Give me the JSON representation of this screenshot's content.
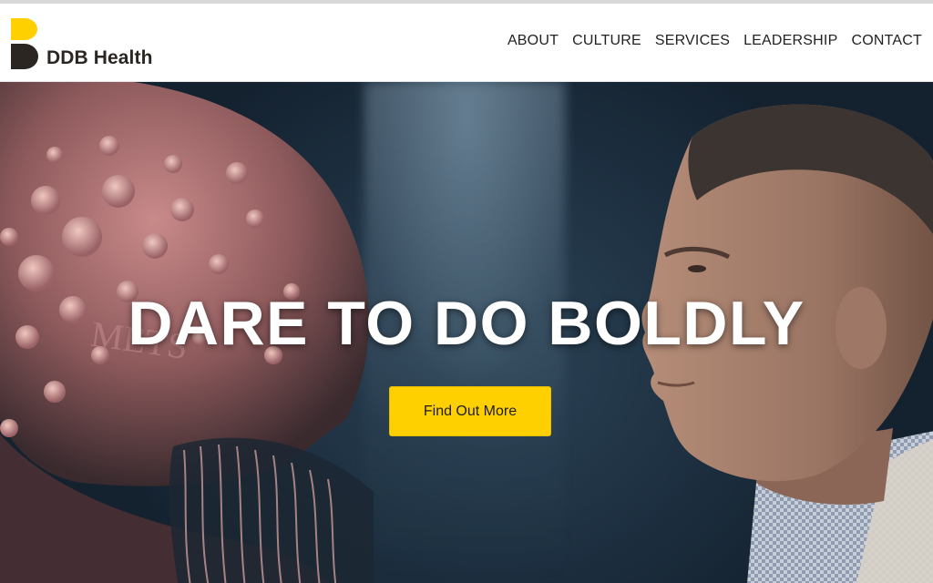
{
  "brand": {
    "name": "DDB Health",
    "logo_icon": "ddb-b-mark",
    "colors": {
      "yellow": "#ffd000",
      "dark": "#2b2622"
    }
  },
  "nav": {
    "items": [
      {
        "label": "ABOUT"
      },
      {
        "label": "CULTURE"
      },
      {
        "label": "SERVICES"
      },
      {
        "label": "LEADERSHIP"
      },
      {
        "label": "CONTACT"
      }
    ]
  },
  "hero": {
    "headline": "DARE TO DO BOLDLY",
    "cta_label": "Find Out More",
    "cta_color": "#ffd000",
    "image_left": "tumor-creature-illustration",
    "image_right": "man-profile-photo",
    "creature_lettering": "METS"
  }
}
